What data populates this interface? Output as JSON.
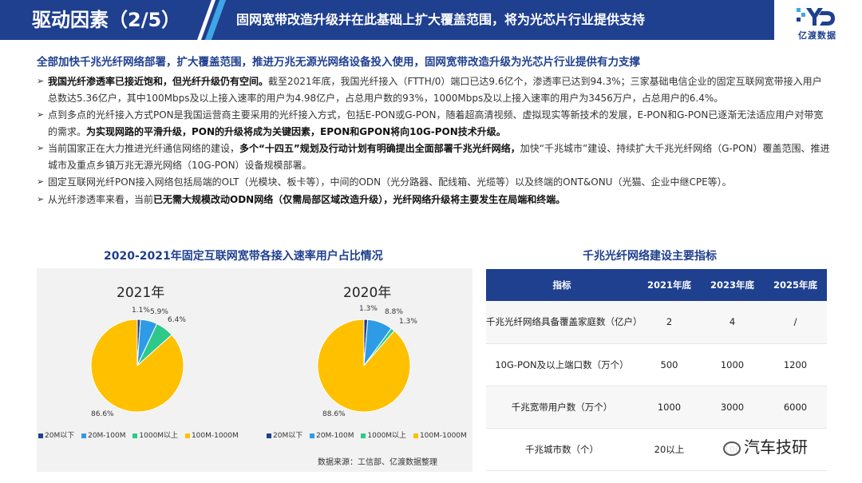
{
  "header": {
    "section": "驱动因素（2/5）",
    "title": "固网宽带改造升级并在此基础上扩大覆盖范围，将为光芯片行业提供支持",
    "logo_text": "亿渡数据"
  },
  "subtitle": "全部加快千兆光纤网络部署，扩大覆盖范围，推进万兆无源光网络设备投入使用，固网宽带改造升级为光芯片行业提供有力支撑",
  "bullets": [
    {
      "bold1": "我国光纤渗透率已接近饱和，但光纤升级仍有空间。",
      "text1": "截至2021年底，我国光纤接入（FTTH/0）端口已达9.6亿个，渗透率已达到94.3%；三家基础电信企业的固定互联网宽带接入用户总数达5.36亿户，其中100Mbps及以上接入速率的用户为4.98亿户，占总用户数的93%，1000Mbps及以上接入速率的用户为3456万户，占总用户的6.4%。",
      "bold2": "",
      "text2": ""
    },
    {
      "bold1": "",
      "text1": "点到多点的光纤接入方式PON是我国运营商主要采用的光纤接入方式，包括E-PON或G-PON，随着超高清视频、虚拟现实等新技术的发展，E-PON和G-PON已逐渐无法适应用户对带宽的需求。",
      "bold2": "为实现网路的平滑升级，PON的升级将成为关键因素，EPON和GPON将向10G-PON技术升级。",
      "text2": ""
    },
    {
      "bold1": "",
      "text1": "当前国家正在大力推进光纤通信网络的建设，",
      "bold2": "多个“十四五”规划及行动计划有明确提出全面部署千兆光纤网络，",
      "text2": "加快“千兆城市”建设、持续扩大千兆光纤网络（G-PON）覆盖范围、推进城市及重点乡镇万兆无源光网络（10G-PON）设备规模部署。"
    },
    {
      "bold1": "",
      "text1": "固定互联网光纤PON接入网络包括局端的OLT（光模块、板卡等），中间的ODN（光分路器、配线箱、光缆等）以及终端的ONT&ONU（光猫、企业中继CPE等）。",
      "bold2": "",
      "text2": ""
    },
    {
      "bold1": "",
      "text1": "从光纤渗透率来看，当前",
      "bold2": "已无需大规模改动ODN网络（仅需局部区域改造升级），光纤网络升级将主要发生在局端和终端。",
      "text2": ""
    }
  ],
  "pie_section": {
    "title": "2020-2021年固定互联网宽带各接入速率用户占比情况",
    "source": "数据来源：工信部、亿渡数据整理"
  },
  "chart_data": [
    {
      "type": "pie",
      "title": "2021年",
      "categories": [
        "20M以下",
        "20M-100M",
        "1000M以上",
        "100M-1000M"
      ],
      "values": [
        1.1,
        5.9,
        6.4,
        86.6
      ],
      "labels": [
        "1.1%",
        "5.9%",
        "6.4%",
        "86.6%"
      ],
      "colors": [
        "#1f3f8f",
        "#2e9be6",
        "#2ec98a",
        "#ffc000"
      ]
    },
    {
      "type": "pie",
      "title": "2020年",
      "categories": [
        "20M以下",
        "20M-100M",
        "1000M以上",
        "100M-1000M"
      ],
      "values": [
        1.3,
        8.8,
        1.3,
        88.6
      ],
      "labels": [
        "1.3%",
        "8.8%",
        "1.3%",
        "88.6%"
      ],
      "colors": [
        "#1f3f8f",
        "#2e9be6",
        "#2ec98a",
        "#ffc000"
      ]
    }
  ],
  "table": {
    "title": "千兆光纤网络建设主要指标",
    "headers": [
      "指标",
      "2021年底",
      "2023年底",
      "2025年底"
    ],
    "rows": [
      [
        "千兆光纤网络具备覆盖家庭数（亿户）",
        "2",
        "4",
        "/"
      ],
      [
        "10G-PON及以上端口数（万个）",
        "500",
        "1000",
        "1200"
      ],
      [
        "千兆宽带用户数（万个）",
        "1000",
        "3000",
        "6000"
      ],
      [
        "千兆城市数（个）",
        "20以上",
        "100",
        ""
      ]
    ]
  },
  "watermark": "汽车技研"
}
